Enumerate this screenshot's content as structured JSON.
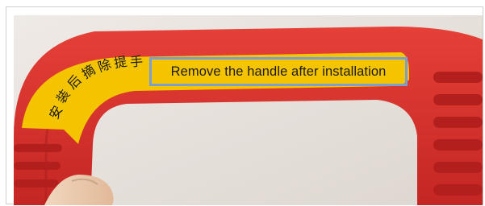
{
  "photo": {
    "subject": "red-plastic-handle",
    "colors": {
      "plastic": "#d9322f",
      "plastic_shadow": "#a81e1d",
      "label_band": "#f4c400",
      "background": "#e9e4df",
      "highlight_box": "#7b9fcf"
    },
    "chinese_label": [
      "安",
      "装",
      "后",
      "摘",
      "除",
      "提",
      "手"
    ],
    "english_label": "Remove the handle after installation"
  }
}
